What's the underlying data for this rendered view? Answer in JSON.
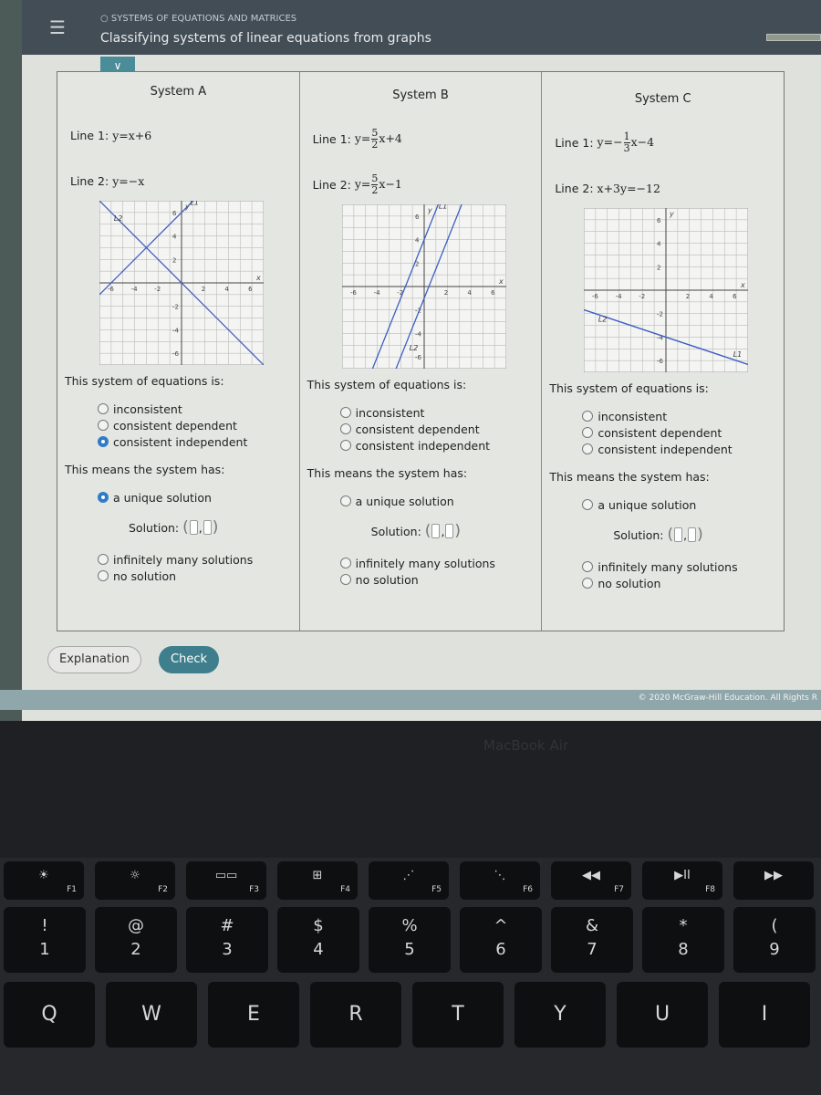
{
  "header": {
    "topic": "SYSTEMS OF EQUATIONS AND MATRICES",
    "title": "Classifying systems of linear equations from graphs",
    "menu_icon": "hamburger-icon",
    "chevron_icon": "chevron-down-icon"
  },
  "prompt": {
    "question1": "This system of equations is:",
    "question2": "This means the system has:",
    "solution_label": "Solution:",
    "type_options": [
      "inconsistent",
      "consistent dependent",
      "consistent independent"
    ],
    "unique": "a unique solution",
    "infinite": "infinitely many solutions",
    "none": "no solution"
  },
  "systems": [
    {
      "name": "System A",
      "line1_label": "Line 1:",
      "line1": {
        "lhs": "y=",
        "num": "",
        "den": "",
        "rest": "x+6",
        "sign": ""
      },
      "line2_label": "Line 2:",
      "line2": {
        "lhs": "y=",
        "num": "",
        "den": "",
        "rest": "−x",
        "sign": ""
      },
      "lines": [
        {
          "label": "L1",
          "slope": 1,
          "intercept": 6
        },
        {
          "label": "L2",
          "slope": -1,
          "intercept": 0
        }
      ],
      "selected_type": "consistent independent",
      "selected_solution": "a unique solution"
    },
    {
      "name": "System B",
      "line1_label": "Line 1:",
      "line1": {
        "lhs": "y=",
        "sign": "",
        "num": "5",
        "den": "2",
        "rest": "x+4"
      },
      "line2_label": "Line 2:",
      "line2": {
        "lhs": "y=",
        "sign": "",
        "num": "5",
        "den": "2",
        "rest": "x−1"
      },
      "lines": [
        {
          "label": "L1",
          "slope": 2.5,
          "intercept": 4
        },
        {
          "label": "L2",
          "slope": 2.5,
          "intercept": -1
        }
      ],
      "selected_type": null,
      "selected_solution": null
    },
    {
      "name": "System C",
      "line1_label": "Line 1:",
      "line1": {
        "lhs": "y=",
        "sign": "−",
        "num": "1",
        "den": "3",
        "rest": "x−4"
      },
      "line2_label": "Line 2:",
      "line2": {
        "lhs": "x+3y=−12",
        "sign": "",
        "num": "",
        "den": "",
        "rest": ""
      },
      "lines": [
        {
          "label": "L1",
          "slope": -0.3333,
          "intercept": -4
        },
        {
          "label": "L2",
          "slope": -0.3333,
          "intercept": -4
        }
      ],
      "selected_type": null,
      "selected_solution": null
    }
  ],
  "graph": {
    "xlim": [
      -7,
      7
    ],
    "ylim": [
      -7,
      7
    ],
    "ticks": [
      -6,
      -4,
      -2,
      2,
      4,
      6
    ],
    "x_label": "x",
    "y_label": "y",
    "line_color": "#3d5fc4"
  },
  "buttons": {
    "explanation": "Explanation",
    "check": "Check"
  },
  "footer": {
    "copyright": "© 2020 McGraw-Hill Education. All Rights R"
  },
  "bezel": {
    "brand": "MacBook Air"
  },
  "keyboard": {
    "fn_row": [
      {
        "icon": "☀",
        "label": "F1"
      },
      {
        "icon": "☼",
        "label": "F2"
      },
      {
        "icon": "▭▭",
        "label": "F3"
      },
      {
        "icon": "⊞",
        "label": "F4"
      },
      {
        "icon": "⋰",
        "label": "F5"
      },
      {
        "icon": "⋱",
        "label": "F6"
      },
      {
        "icon": "◀◀",
        "label": "F7"
      },
      {
        "icon": "▶II",
        "label": "F8"
      },
      {
        "icon": "▶▶",
        "label": ""
      }
    ],
    "num_row": [
      {
        "top": "!",
        "bot": "1"
      },
      {
        "top": "@",
        "bot": "2"
      },
      {
        "top": "#",
        "bot": "3"
      },
      {
        "top": "$",
        "bot": "4"
      },
      {
        "top": "%",
        "bot": "5"
      },
      {
        "top": "^",
        "bot": "6"
      },
      {
        "top": "&",
        "bot": "7"
      },
      {
        "top": "*",
        "bot": "8"
      },
      {
        "top": "(",
        "bot": "9"
      }
    ],
    "letter_row": [
      "Q",
      "W",
      "E",
      "R",
      "T",
      "Y",
      "U",
      "I"
    ]
  }
}
